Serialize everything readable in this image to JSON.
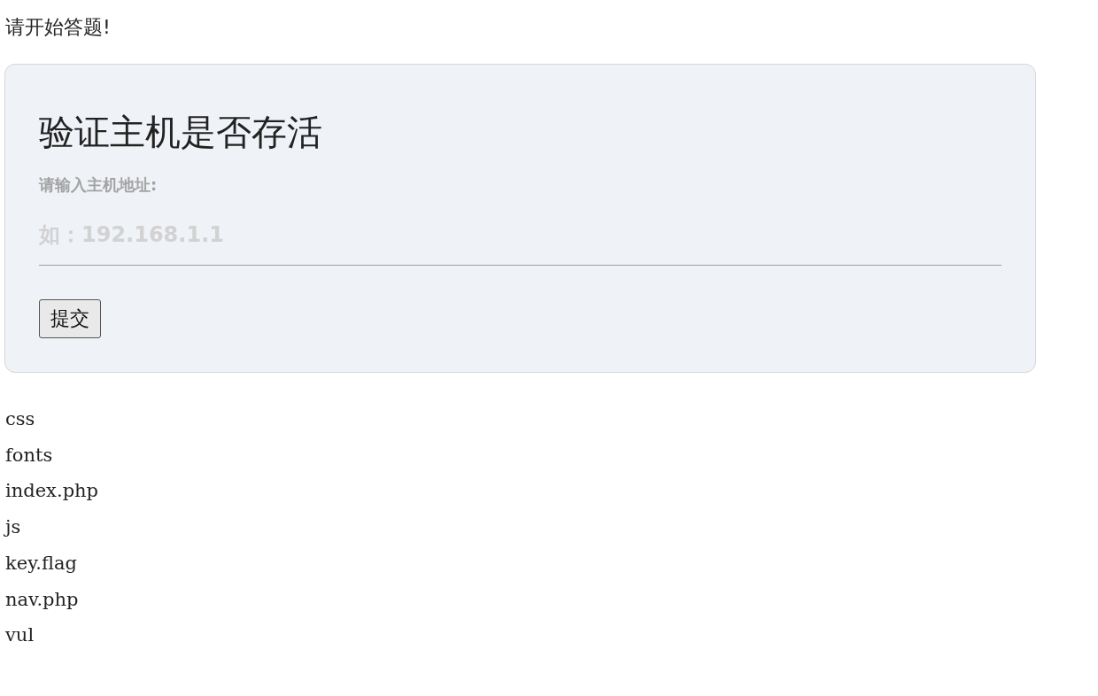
{
  "prompt": "请开始答题!",
  "form": {
    "title": "验证主机是否存活",
    "label": "请输入主机地址:",
    "placeholder": "如：192.168.1.1",
    "button": "提交"
  },
  "files": [
    "css",
    "fonts",
    "index.php",
    "js",
    "key.flag",
    "nav.php",
    "vul"
  ]
}
